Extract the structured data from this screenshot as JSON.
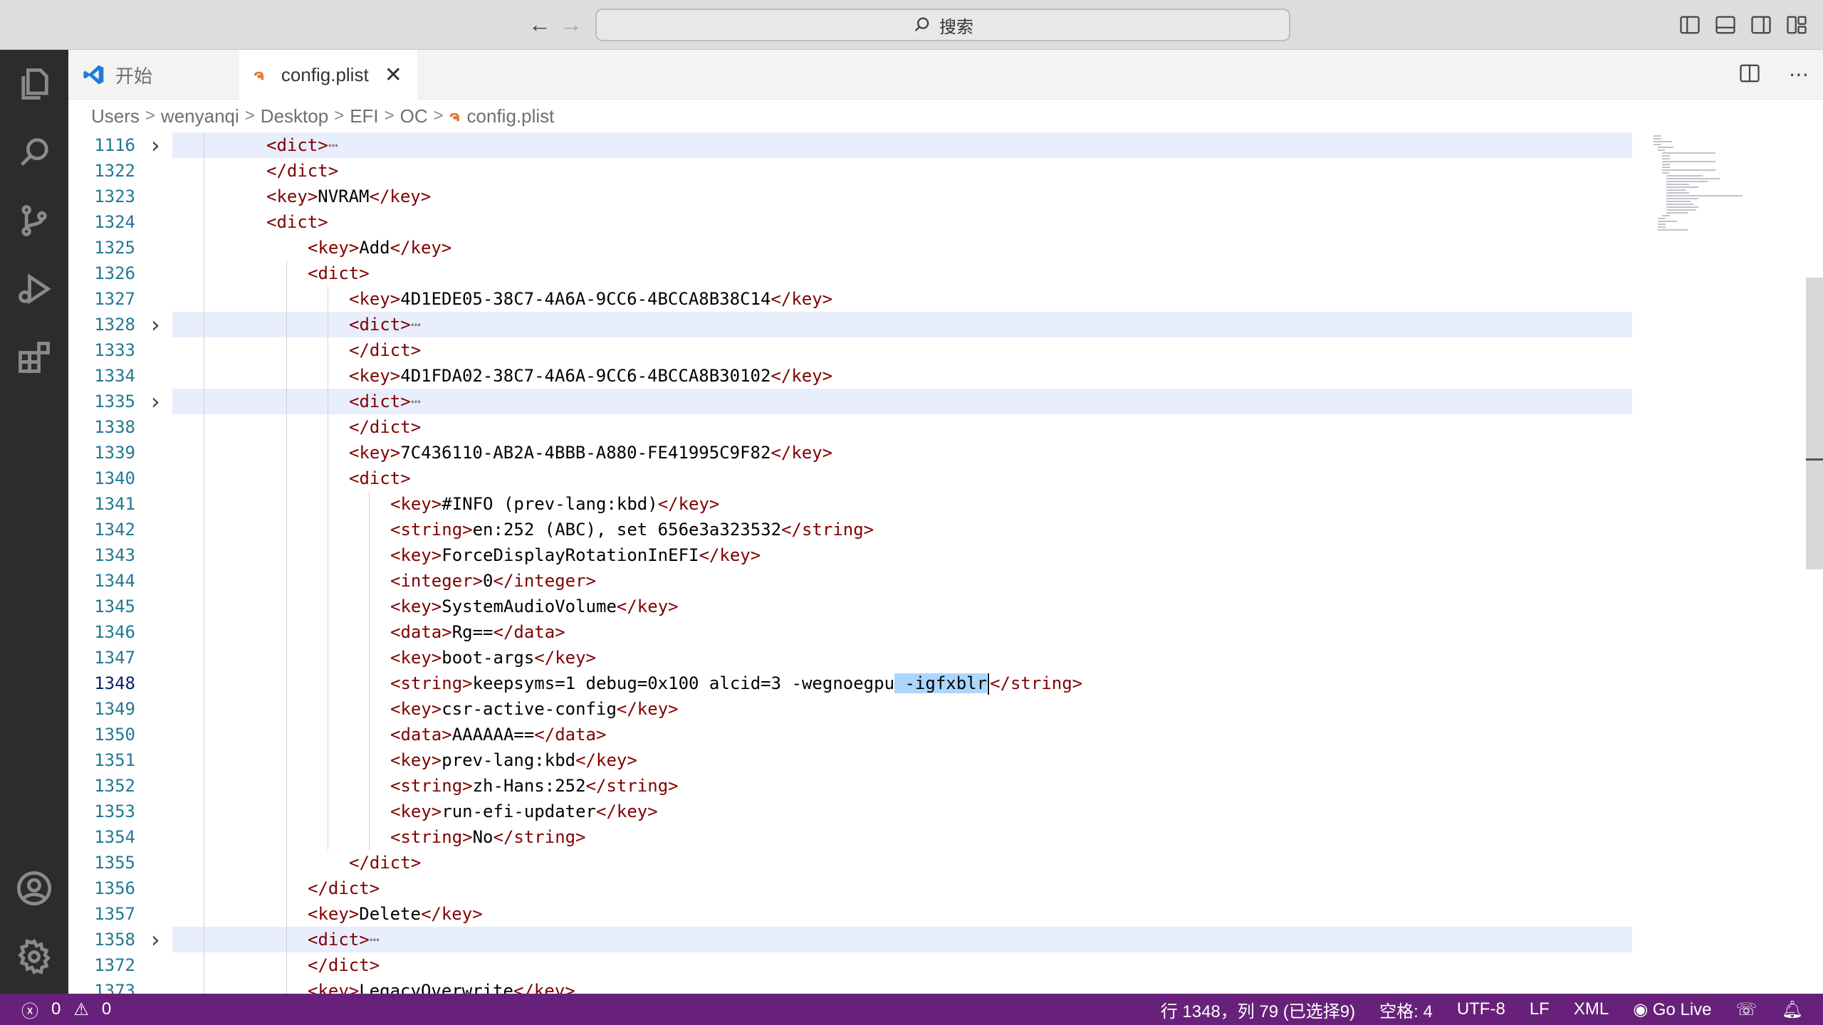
{
  "titlebar": {
    "search_placeholder": "搜索",
    "search_icon": "search-icon"
  },
  "tabs": [
    {
      "label": "开始",
      "icon": "vscode-logo-icon"
    },
    {
      "label": "config.plist",
      "icon": "rss-file-icon",
      "close": "✕"
    }
  ],
  "breadcrumb": [
    "Users",
    "wenyanqi",
    "Desktop",
    "EFI",
    "OC",
    "config.plist"
  ],
  "editor": {
    "lines": [
      {
        "n": "1116",
        "fold": true,
        "hl": true,
        "indent": 2,
        "parts": [
          [
            "t",
            "<dict>"
          ],
          [
            "e",
            "⋯"
          ]
        ]
      },
      {
        "n": "1322",
        "indent": 2,
        "parts": [
          [
            "t",
            "</dict>"
          ]
        ]
      },
      {
        "n": "1323",
        "indent": 2,
        "parts": [
          [
            "t",
            "<key>"
          ],
          [
            "x",
            "NVRAM"
          ],
          [
            "t",
            "</key>"
          ]
        ]
      },
      {
        "n": "1324",
        "indent": 2,
        "parts": [
          [
            "t",
            "<dict>"
          ]
        ]
      },
      {
        "n": "1325",
        "indent": 3,
        "parts": [
          [
            "t",
            "<key>"
          ],
          [
            "x",
            "Add"
          ],
          [
            "t",
            "</key>"
          ]
        ]
      },
      {
        "n": "1326",
        "indent": 3,
        "parts": [
          [
            "t",
            "<dict>"
          ]
        ]
      },
      {
        "n": "1327",
        "indent": 4,
        "parts": [
          [
            "t",
            "<key>"
          ],
          [
            "x",
            "4D1EDE05-38C7-4A6A-9CC6-4BCCA8B38C14"
          ],
          [
            "t",
            "</key>"
          ]
        ]
      },
      {
        "n": "1328",
        "fold": true,
        "hl": true,
        "indent": 4,
        "parts": [
          [
            "t",
            "<dict>"
          ],
          [
            "e",
            "⋯"
          ]
        ]
      },
      {
        "n": "1333",
        "indent": 4,
        "parts": [
          [
            "t",
            "</dict>"
          ]
        ]
      },
      {
        "n": "1334",
        "indent": 4,
        "parts": [
          [
            "t",
            "<key>"
          ],
          [
            "x",
            "4D1FDA02-38C7-4A6A-9CC6-4BCCA8B30102"
          ],
          [
            "t",
            "</key>"
          ]
        ]
      },
      {
        "n": "1335",
        "fold": true,
        "hl": true,
        "indent": 4,
        "parts": [
          [
            "t",
            "<dict>"
          ],
          [
            "e",
            "⋯"
          ]
        ]
      },
      {
        "n": "1338",
        "indent": 4,
        "parts": [
          [
            "t",
            "</dict>"
          ]
        ]
      },
      {
        "n": "1339",
        "indent": 4,
        "parts": [
          [
            "t",
            "<key>"
          ],
          [
            "x",
            "7C436110-AB2A-4BBB-A880-FE41995C9F82"
          ],
          [
            "t",
            "</key>"
          ]
        ]
      },
      {
        "n": "1340",
        "indent": 4,
        "parts": [
          [
            "t",
            "<dict>"
          ]
        ]
      },
      {
        "n": "1341",
        "indent": 5,
        "parts": [
          [
            "t",
            "<key>"
          ],
          [
            "x",
            "#INFO (prev-lang:kbd)"
          ],
          [
            "t",
            "</key>"
          ]
        ]
      },
      {
        "n": "1342",
        "indent": 5,
        "parts": [
          [
            "t",
            "<string>"
          ],
          [
            "x",
            "en:252 (ABC), set 656e3a323532"
          ],
          [
            "t",
            "</string>"
          ]
        ]
      },
      {
        "n": "1343",
        "indent": 5,
        "parts": [
          [
            "t",
            "<key>"
          ],
          [
            "x",
            "ForceDisplayRotationInEFI"
          ],
          [
            "t",
            "</key>"
          ]
        ]
      },
      {
        "n": "1344",
        "indent": 5,
        "parts": [
          [
            "t",
            "<integer>"
          ],
          [
            "x",
            "0"
          ],
          [
            "t",
            "</integer>"
          ]
        ]
      },
      {
        "n": "1345",
        "indent": 5,
        "parts": [
          [
            "t",
            "<key>"
          ],
          [
            "x",
            "SystemAudioVolume"
          ],
          [
            "t",
            "</key>"
          ]
        ]
      },
      {
        "n": "1346",
        "indent": 5,
        "parts": [
          [
            "t",
            "<data>"
          ],
          [
            "x",
            "Rg=="
          ],
          [
            "t",
            "</data>"
          ]
        ]
      },
      {
        "n": "1347",
        "indent": 5,
        "parts": [
          [
            "t",
            "<key>"
          ],
          [
            "x",
            "boot-args"
          ],
          [
            "t",
            "</key>"
          ]
        ]
      },
      {
        "n": "1348",
        "cur": true,
        "indent": 5,
        "parts": [
          [
            "t",
            "<string>"
          ],
          [
            "x",
            "keepsyms=1 debug=0x100 alcid=3 -wegnoegpu"
          ],
          [
            "s",
            " -igfxblr"
          ],
          [
            "c",
            ""
          ],
          [
            "t",
            "</string>"
          ]
        ]
      },
      {
        "n": "1349",
        "indent": 5,
        "parts": [
          [
            "t",
            "<key>"
          ],
          [
            "x",
            "csr-active-config"
          ],
          [
            "t",
            "</key>"
          ]
        ]
      },
      {
        "n": "1350",
        "indent": 5,
        "parts": [
          [
            "t",
            "<data>"
          ],
          [
            "x",
            "AAAAAA=="
          ],
          [
            "t",
            "</data>"
          ]
        ]
      },
      {
        "n": "1351",
        "indent": 5,
        "parts": [
          [
            "t",
            "<key>"
          ],
          [
            "x",
            "prev-lang:kbd"
          ],
          [
            "t",
            "</key>"
          ]
        ]
      },
      {
        "n": "1352",
        "indent": 5,
        "parts": [
          [
            "t",
            "<string>"
          ],
          [
            "x",
            "zh-Hans:252"
          ],
          [
            "t",
            "</string>"
          ]
        ]
      },
      {
        "n": "1353",
        "indent": 5,
        "parts": [
          [
            "t",
            "<key>"
          ],
          [
            "x",
            "run-efi-updater"
          ],
          [
            "t",
            "</key>"
          ]
        ]
      },
      {
        "n": "1354",
        "indent": 5,
        "parts": [
          [
            "t",
            "<string>"
          ],
          [
            "x",
            "No"
          ],
          [
            "t",
            "</string>"
          ]
        ]
      },
      {
        "n": "1355",
        "indent": 4,
        "parts": [
          [
            "t",
            "</dict>"
          ]
        ]
      },
      {
        "n": "1356",
        "indent": 3,
        "parts": [
          [
            "t",
            "</dict>"
          ]
        ]
      },
      {
        "n": "1357",
        "indent": 3,
        "parts": [
          [
            "t",
            "<key>"
          ],
          [
            "x",
            "Delete"
          ],
          [
            "t",
            "</key>"
          ]
        ]
      },
      {
        "n": "1358",
        "fold": true,
        "hl": true,
        "indent": 3,
        "parts": [
          [
            "t",
            "<dict>"
          ],
          [
            "e",
            "⋯"
          ]
        ]
      },
      {
        "n": "1372",
        "indent": 3,
        "parts": [
          [
            "t",
            "</dict>"
          ]
        ]
      },
      {
        "n": "1373",
        "indent": 3,
        "parts": [
          [
            "t",
            "<key>"
          ],
          [
            "x",
            "LegacyOverwrite"
          ],
          [
            "t",
            "</key>"
          ]
        ]
      }
    ]
  },
  "statusbar": {
    "errors": "0",
    "warnings": "0",
    "position": "行 1348，列 79 (已选择9)",
    "spaces": "空格: 4",
    "encoding": "UTF-8",
    "eol": "LF",
    "language": "XML",
    "golive": "Go Live"
  },
  "colors": {
    "statusbar": "#68217a",
    "tag": "#800000",
    "linenum": "#237893",
    "selection": "#add6ff"
  }
}
